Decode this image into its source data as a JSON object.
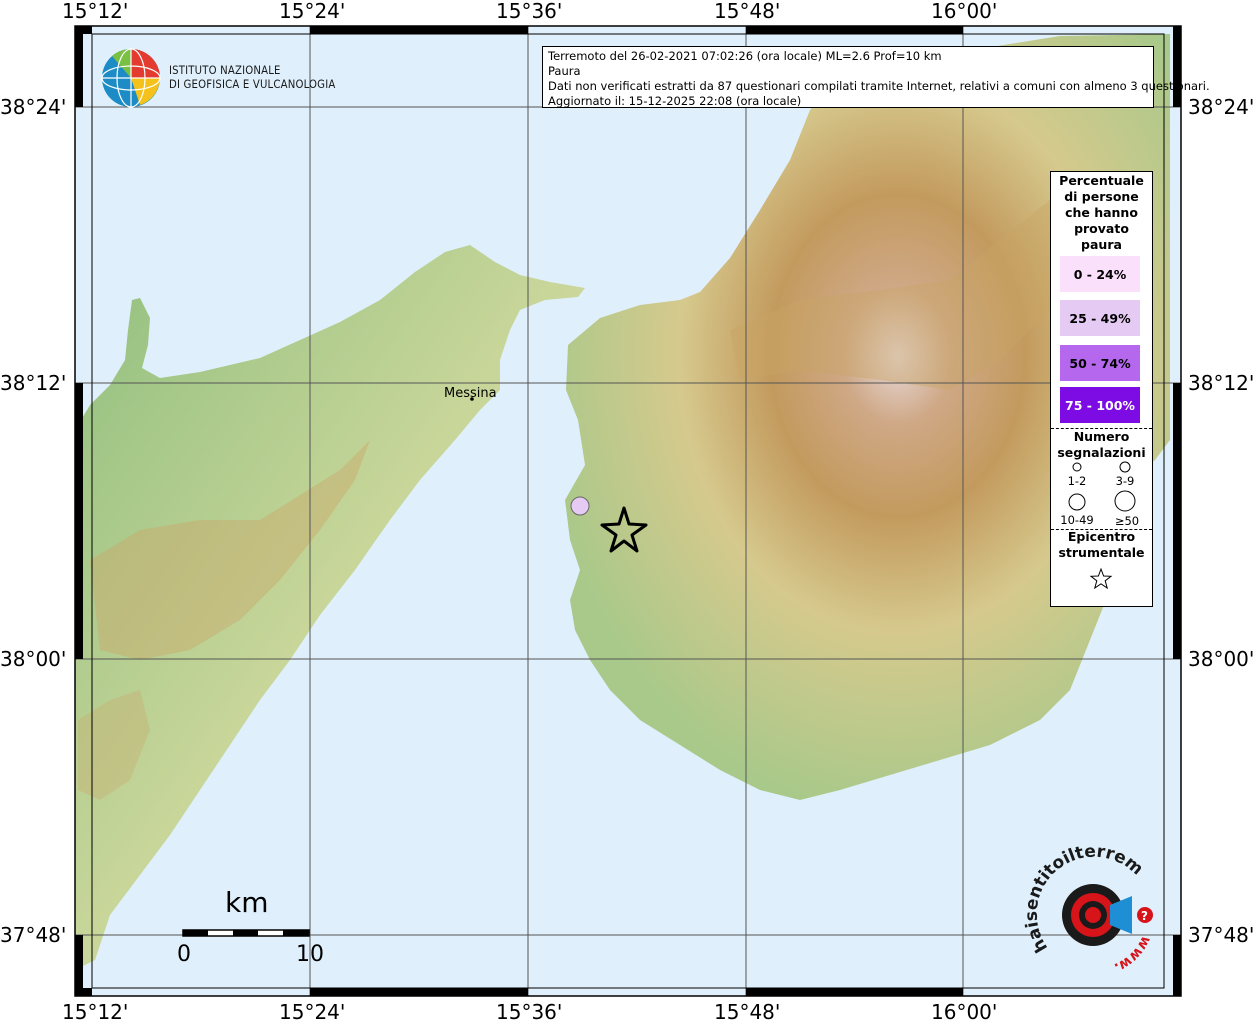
{
  "info": {
    "line1": "Terremoto del 26-02-2021 07:02:26 (ora locale) ML=2.6 Prof=10 km",
    "line2": "Paura",
    "line3": "Dati non verificati estratti da 87 questionari compilati tramite Internet, relativi a comuni con almeno 3 questionari.",
    "line4": "Aggiornato il: 15-12-2025 22:08 (ora locale)"
  },
  "logo": {
    "line1": "ISTITUTO NAZIONALE",
    "line2": "DI GEOFISICA E VULCANOLOGIA"
  },
  "axes": {
    "lon_labels": [
      "15°12'",
      "15°24'",
      "15°36'",
      "15°48'",
      "16°00'"
    ],
    "lat_labels": [
      "38°24'",
      "38°12'",
      "38°00'",
      "37°48'"
    ]
  },
  "city": {
    "name": "Messina"
  },
  "scale": {
    "unit": "km",
    "min": "0",
    "max": "10"
  },
  "legend": {
    "title_lines": [
      "Percentuale",
      "di persone",
      "che hanno",
      "provato",
      "paura"
    ],
    "classes": [
      {
        "label": "0 - 24%",
        "color": "#fbe0fb"
      },
      {
        "label": "25 - 49%",
        "color": "#e5cbf3"
      },
      {
        "label": "50 - 74%",
        "color": "#b567ee"
      },
      {
        "label": "75 - 100%",
        "color": "#7d0be3"
      }
    ],
    "count_title_lines": [
      "Numero",
      "segnalazioni"
    ],
    "count_classes": [
      "1-2",
      "3-9",
      "10-49",
      "≥50"
    ],
    "epicenter_title_lines": [
      "Epicentro",
      "strumentale"
    ]
  },
  "brand": {
    "name": "haisentitoilterremoto.it",
    "url": "www."
  },
  "colors": {
    "sea": "#dff0fc",
    "frame": "#000000"
  }
}
